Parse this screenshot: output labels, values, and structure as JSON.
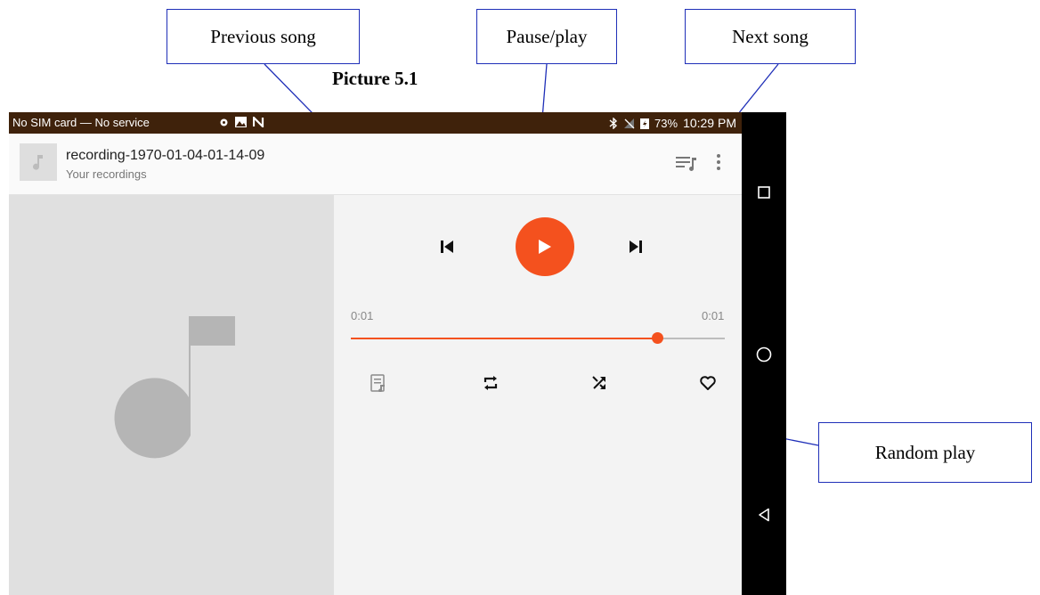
{
  "annotations": {
    "previous": "Previous song",
    "pause_play": "Pause/play",
    "next": "Next song",
    "caption": "Picture 5.1",
    "random": "Random play"
  },
  "status_bar": {
    "carrier": "No SIM card — No service",
    "battery": "73%",
    "time": "10:29 PM"
  },
  "header": {
    "title": "recording-1970-01-04-01-14-09",
    "subtitle": "Your recordings"
  },
  "player": {
    "elapsed": "0:01",
    "duration": "0:01",
    "progress_fraction": 0.82
  },
  "colors": {
    "accent": "#f4511e",
    "status_bar": "#3f220b",
    "annotation_border": "#1f2fb8"
  },
  "icons": {
    "previous": "skip-previous-icon",
    "play": "play-icon",
    "next": "skip-next-icon",
    "queue": "queue-music-icon",
    "repeat": "repeat-icon",
    "shuffle": "shuffle-icon",
    "favorite": "heart-icon"
  }
}
